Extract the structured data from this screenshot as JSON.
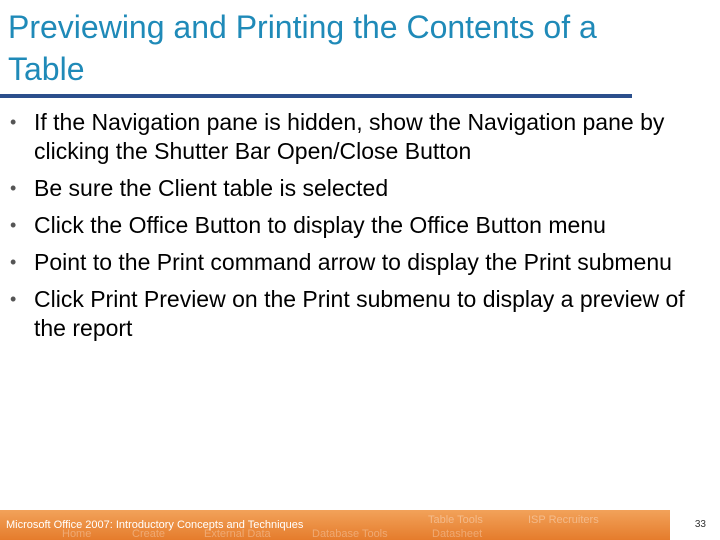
{
  "slide": {
    "title": "Previewing and Printing the Contents of a Table",
    "bullets": [
      "If the Navigation pane is hidden, show the Navigation pane by clicking the Shutter Bar Open/Close Button",
      "Be sure the Client table is selected",
      "Click the Office Button to display the Office Button menu",
      "Point to the Print command arrow to display the Print submenu",
      "Click Print Preview on the Print submenu to display a preview of the report"
    ],
    "bullet_glyph": "•"
  },
  "footer": {
    "text": "Microsoft Office 2007: Introductory Concepts and Techniques",
    "page_number": "33",
    "ghost_labels": [
      "Table Tools",
      "ISP Recruiters",
      "Home",
      "Create",
      "External Data",
      "Database Tools",
      "Datasheet"
    ]
  },
  "colors": {
    "title": "#1f8ab8",
    "rule": "#2b4f8c",
    "footer": "#e57c2c"
  }
}
